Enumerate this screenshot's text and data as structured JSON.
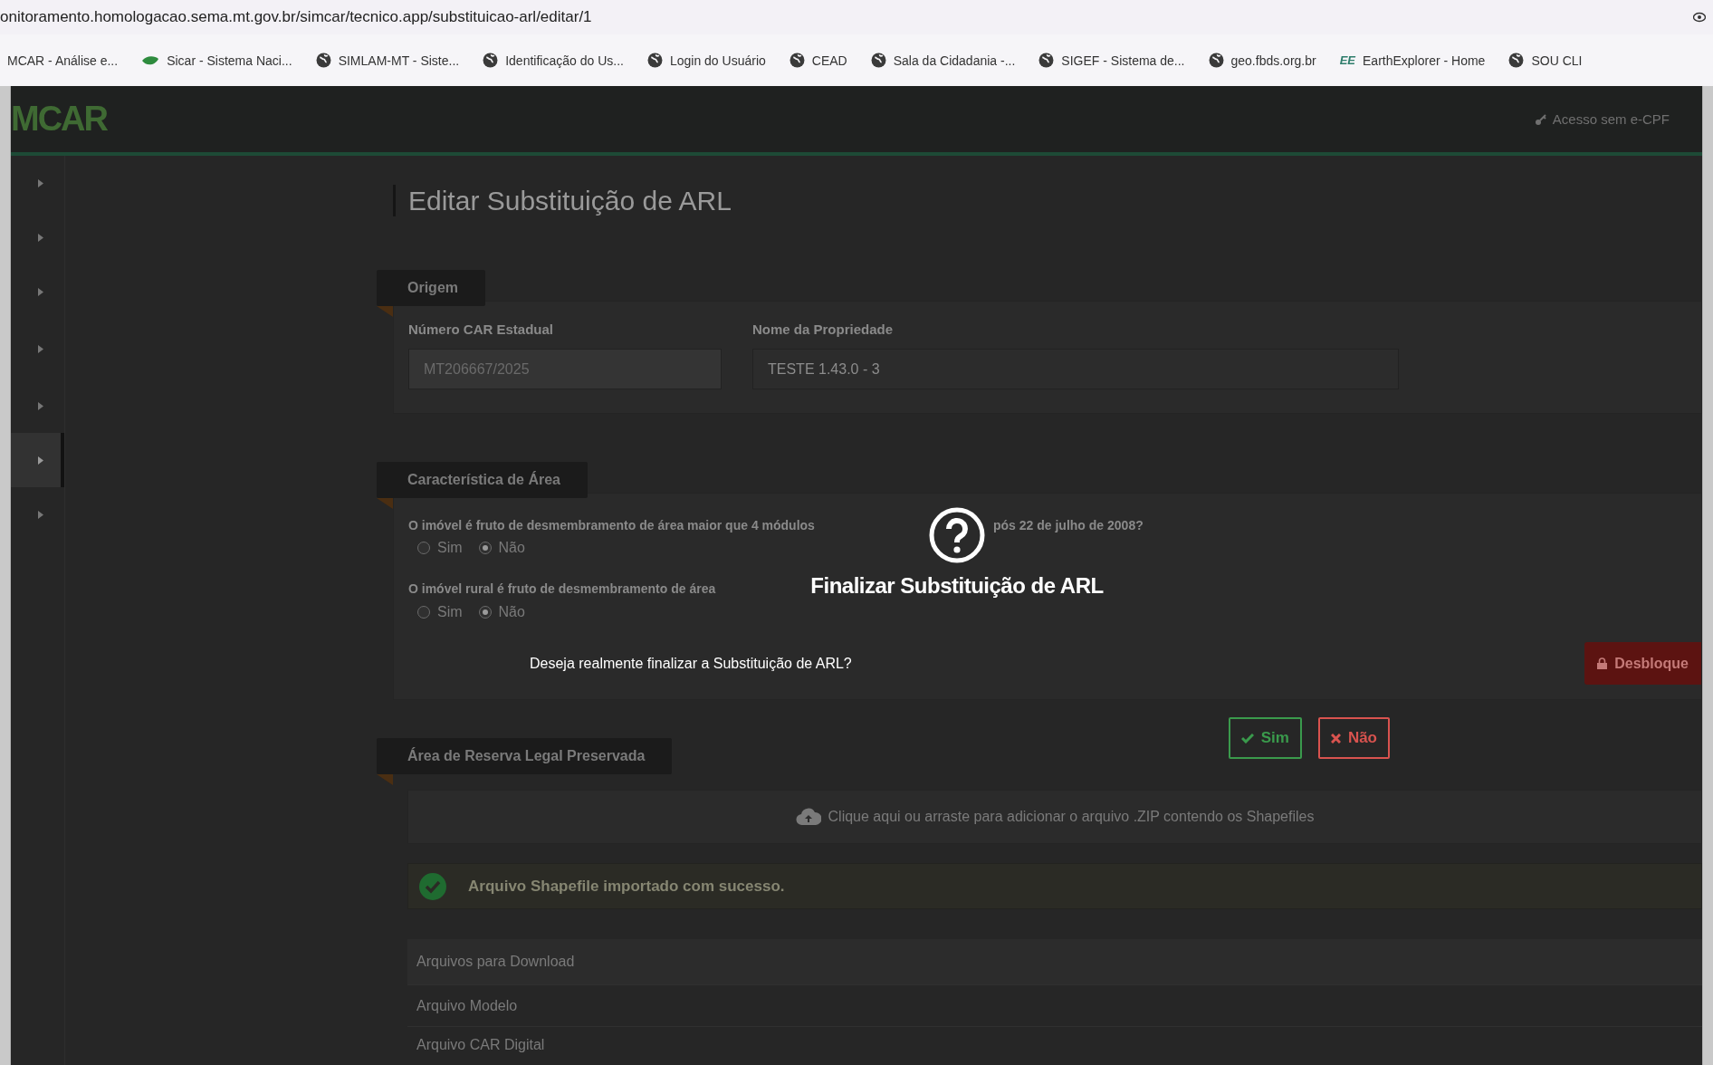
{
  "browser": {
    "url": "onitoramento.homologacao.sema.mt.gov.br/simcar/tecnico.app/substituicao-arl/editar/1",
    "bookmarks": [
      {
        "label": "MCAR - Análise e...",
        "kind": "plain"
      },
      {
        "label": "Sicar - Sistema Naci...",
        "kind": "leaf"
      },
      {
        "label": "SIMLAM-MT - Siste...",
        "kind": "globe"
      },
      {
        "label": "Identificação do Us...",
        "kind": "globe"
      },
      {
        "label": "Login do Usuário",
        "kind": "globe"
      },
      {
        "label": "CEAD",
        "kind": "globe"
      },
      {
        "label": "Sala da Cidadania -...",
        "kind": "globe"
      },
      {
        "label": "SIGEF - Sistema de...",
        "kind": "globe"
      },
      {
        "label": "geo.fbds.org.br",
        "kind": "globe"
      },
      {
        "label": "EarthExplorer - Home",
        "kind": "lettered",
        "icon_text": "EE"
      },
      {
        "label": "SOU CLI",
        "kind": "globe"
      }
    ]
  },
  "header": {
    "logo": "MCAR",
    "login_link": "Acesso sem e-CPF"
  },
  "sidebar": {
    "items": [
      {
        "selected": false
      },
      {
        "selected": false
      },
      {
        "selected": false
      },
      {
        "selected": false
      },
      {
        "selected": false
      },
      {
        "selected": true
      },
      {
        "selected": false
      }
    ]
  },
  "page_title": "Editar Substituição de ARL",
  "origem": {
    "title": "Origem",
    "fields": [
      {
        "label": "Número CAR Estadual",
        "value": "MT206667/2025",
        "disabled": true
      },
      {
        "label": "Nome da Propriedade",
        "value": "TESTE 1.43.0 - 3",
        "disabled": false
      }
    ]
  },
  "caracteristica": {
    "title": "Característica de Área",
    "questions": [
      {
        "parts": [
          "O imóvel é fruto de desmembramento de área maior que 4 módulos",
          "pós 22 de julho de 2008?"
        ],
        "options": [
          {
            "label": "Sim",
            "selected": false
          },
          {
            "label": "Não",
            "selected": true
          }
        ]
      },
      {
        "parts": [
          "O imóvel rural é fruto de desmembramento de área"
        ],
        "options": [
          {
            "label": "Sim",
            "selected": false
          },
          {
            "label": "Não",
            "selected": true
          }
        ]
      }
    ],
    "unlock_button": "Desbloque"
  },
  "reserva": {
    "title": "Área de Reserva Legal Preservada",
    "dropzone": "Clique aqui ou arraste para adicionar o arquivo .ZIP contendo os Shapefiles",
    "success": "Arquivo Shapefile importado com sucesso.",
    "table": {
      "header": "Arquivos para Download",
      "rows": [
        "Arquivo Modelo",
        "Arquivo CAR Digital"
      ]
    }
  },
  "dialog": {
    "title": "Finalizar Substituição de ARL",
    "message": "Deseja realmente finalizar a Substituição de ARL?",
    "confirm": "Sim",
    "cancel": "Não"
  }
}
